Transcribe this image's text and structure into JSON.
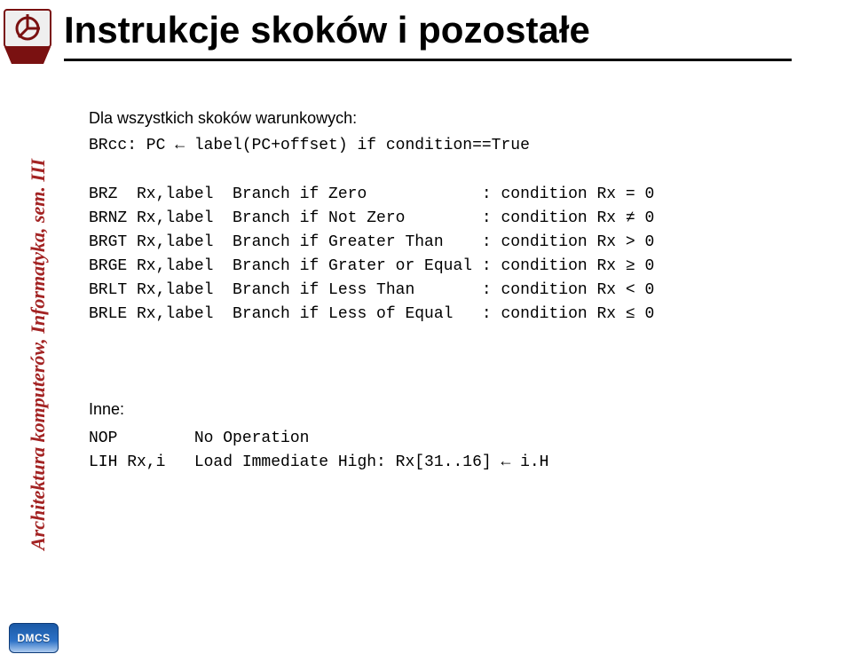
{
  "sidebar_text": "Architektura komputerów, Informatyka, sem. III",
  "title": "Instrukcje skoków i pozostałe",
  "intro_line": "Dla wszystkich skoków warunkowych:",
  "brcc_line": "BRcc: PC ← label(PC+offset) if condition==True",
  "branch_table": [
    {
      "op": "BRZ  Rx,label",
      "desc": "Branch if Zero           ",
      "cond": ": condition Rx = 0"
    },
    {
      "op": "BRNZ Rx,label",
      "desc": "Branch if Not Zero       ",
      "cond": ": condition Rx ≠ 0"
    },
    {
      "op": "BRGT Rx,label",
      "desc": "Branch if Greater Than   ",
      "cond": ": condition Rx > 0"
    },
    {
      "op": "BRGE Rx,label",
      "desc": "Branch if Grater or Equal",
      "cond": ": condition Rx ≥ 0"
    },
    {
      "op": "BRLT Rx,label",
      "desc": "Branch if Less Than      ",
      "cond": ": condition Rx < 0"
    },
    {
      "op": "BRLE Rx,label",
      "desc": "Branch if Less of Equal  ",
      "cond": ": condition Rx ≤ 0"
    }
  ],
  "other_label": "Inne:",
  "other_table": [
    {
      "op": "NOP       ",
      "desc": "No Operation"
    },
    {
      "op": "LIH Rx,i  ",
      "desc": "Load Immediate High: Rx[31..16] ← i.H"
    }
  ],
  "badge": "DMCS"
}
